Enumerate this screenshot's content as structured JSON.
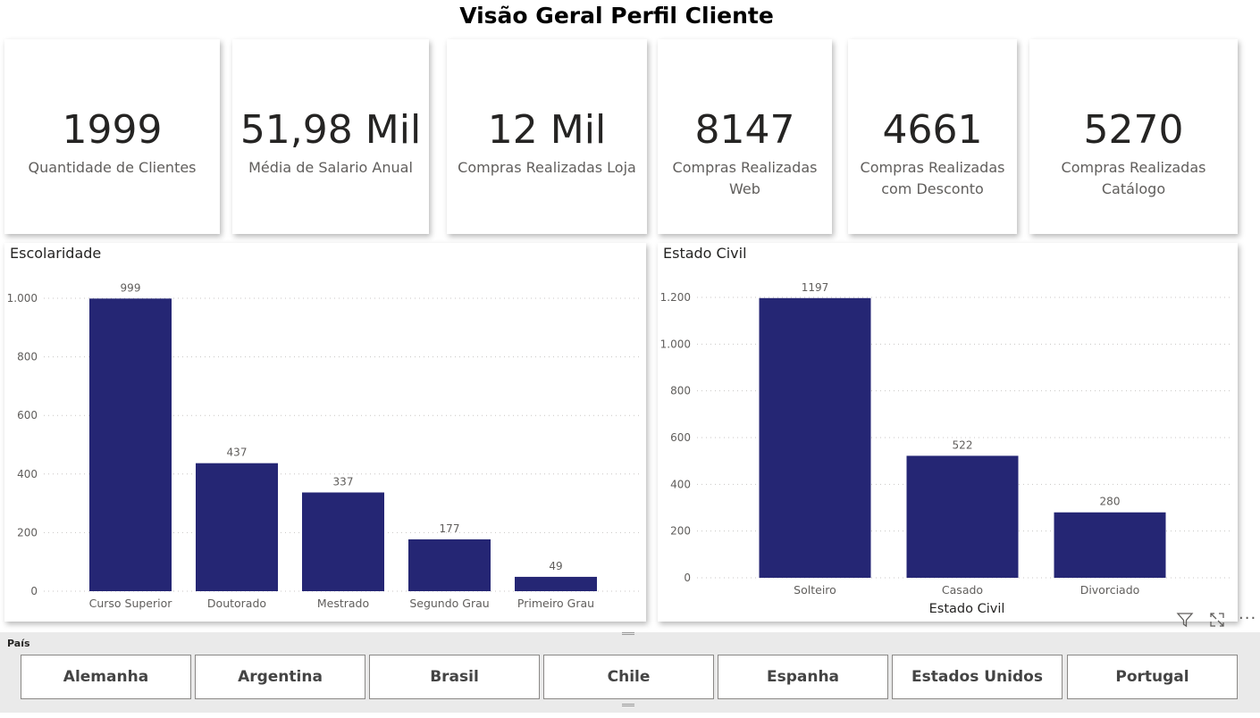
{
  "page": {
    "title": "Visão Geral Perfil Cliente"
  },
  "kpis": [
    {
      "value": "1999",
      "label": "Quantidade de Clientes"
    },
    {
      "value": "51,98 Mil",
      "label": "Média de Salario Anual"
    },
    {
      "value": "12 Mil",
      "label": "Compras Realizadas Loja"
    },
    {
      "value": "8147",
      "label": "Compras Realizadas Web"
    },
    {
      "value": "4661",
      "label": "Compras Realizadas com Desconto"
    },
    {
      "value": "5270",
      "label": "Compras Realizadas Catálogo"
    }
  ],
  "chart_data": [
    {
      "type": "bar",
      "title": "Escolaridade",
      "xlabel": "",
      "ylabel": "",
      "categories": [
        "Curso Superior",
        "Doutorado",
        "Mestrado",
        "Segundo Grau",
        "Primeiro Grau"
      ],
      "values": [
        999,
        437,
        337,
        177,
        49
      ],
      "yticks": [
        "0",
        "200",
        "400",
        "600",
        "800",
        "1.000"
      ],
      "ylim": [
        0,
        1000
      ],
      "grid": true,
      "color": "#252674"
    },
    {
      "type": "bar",
      "title": "Estado Civil",
      "xlabel": "Estado Civil",
      "ylabel": "",
      "categories": [
        "Solteiro",
        "Casado",
        "Divorciado"
      ],
      "values": [
        1197,
        522,
        280
      ],
      "yticks": [
        "0",
        "200",
        "400",
        "600",
        "800",
        "1.000",
        "1.200"
      ],
      "ylim": [
        0,
        1200
      ],
      "grid": true,
      "color": "#252674"
    }
  ],
  "visual_header": {
    "icons": [
      "filter-icon",
      "focus-mode-icon",
      "more-options-icon"
    ]
  },
  "slicer": {
    "title": "País",
    "options": [
      "Alemanha",
      "Argentina",
      "Brasil",
      "Chile",
      "Espanha",
      "Estados Unidos",
      "Portugal"
    ]
  }
}
